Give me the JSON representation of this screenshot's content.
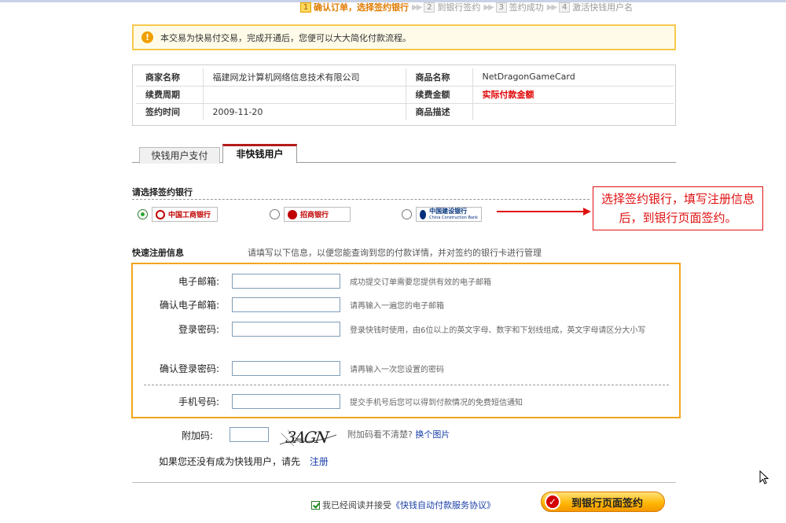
{
  "steps": [
    {
      "num": "1",
      "label": "确认订单，选择签约银行",
      "active": true
    },
    {
      "num": "2",
      "label": "到银行签约",
      "active": false
    },
    {
      "num": "3",
      "label": "签约成功",
      "active": false
    },
    {
      "num": "4",
      "label": "激活快钱用户名",
      "active": false
    }
  ],
  "notice": {
    "icon": "info-icon",
    "text": "本交易为快易付交易，完成开通后，您便可以大大简化付款流程。"
  },
  "merchant": {
    "rows": [
      {
        "l1": "商家名称",
        "v1": "福建网龙计算机网络信息技术有限公司",
        "l2": "商品名称",
        "v2": "NetDragonGameCard"
      },
      {
        "l1": "续费周期",
        "v1": "",
        "l2": "续费金额",
        "v2": "实际付款金额"
      },
      {
        "l1": "签约时间",
        "v1": "2009-11-20",
        "l2": "商品描述",
        "v2": ""
      }
    ]
  },
  "tabs": [
    {
      "label": "快钱用户支付",
      "active": false
    },
    {
      "label": "非快钱用户",
      "active": true
    }
  ],
  "bank_section": {
    "title": "请选择签约银行",
    "banks": [
      {
        "name": "中国工商银行",
        "checked": true
      },
      {
        "name": "招商银行",
        "checked": false
      },
      {
        "name": "中国建设银行",
        "sub": "China Construction Bank",
        "checked": false
      }
    ]
  },
  "callout": {
    "text": "选择签约银行，填写注册信息后，到银行页面签约。"
  },
  "registration": {
    "title": "快速注册信息",
    "hint": "请填写以下信息，以便您能查询到您的付款详情，并对签约的银行卡进行管理",
    "fields": [
      {
        "label": "电子邮箱:",
        "hint": "成功提交订单需要您提供有效的电子邮箱"
      },
      {
        "label": "确认电子邮箱:",
        "hint": "请再输入一遍您的电子邮箱"
      },
      {
        "label": "登录密码:",
        "hint": "登录快钱时使用，由6位以上的英文字母、数字和下划线组成，英文字母请区分大小写"
      },
      {
        "label": "确认登录密码:",
        "hint": "请再输入一次您设置的密码"
      },
      {
        "label": "手机号码:",
        "hint": "提交手机号后您可以得到付款情况的免费短信通知"
      }
    ]
  },
  "captcha": {
    "label": "附加码:",
    "image_text": "3AGN",
    "hint": "附加码看不清楚?",
    "change_link": "换个图片"
  },
  "register": {
    "text": "如果您还没有成为快钱用户，请先",
    "link": "注册"
  },
  "agreement": {
    "prefix": "我已经阅读并接受",
    "link": "《快钱自动付款服务协议》",
    "checked": true
  },
  "submit": {
    "label": "到银行页面签约"
  }
}
